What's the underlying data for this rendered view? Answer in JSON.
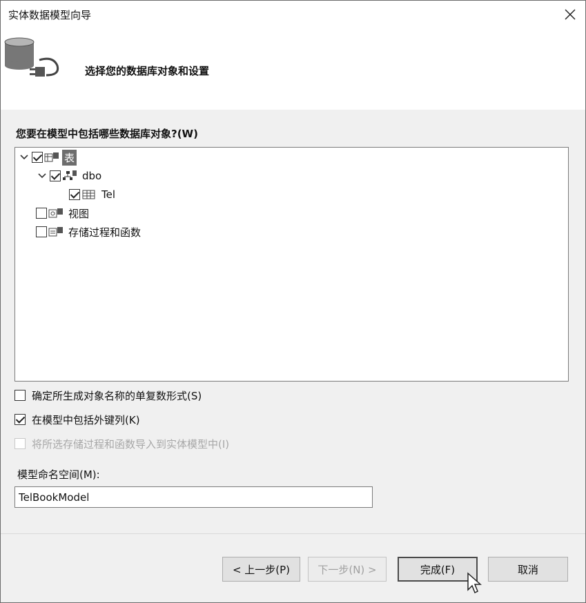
{
  "window": {
    "title": "实体数据模型向导"
  },
  "header": {
    "title": "选择您的数据库对象和设置",
    "icon": "database-connection-icon"
  },
  "objects": {
    "label": "您要在模型中包括哪些数据库对象?(W)",
    "tree": [
      {
        "label": "表",
        "checked": true,
        "expanded": true,
        "selected": true,
        "icon": "tables-icon"
      },
      {
        "label": "dbo",
        "checked": true,
        "expanded": true,
        "selected": false,
        "icon": "schema-icon"
      },
      {
        "label": "Tel",
        "checked": true,
        "selected": false,
        "icon": "table-icon"
      },
      {
        "label": "视图",
        "checked": false,
        "selected": false,
        "icon": "views-icon"
      },
      {
        "label": "存储过程和函数",
        "checked": false,
        "selected": false,
        "icon": "procedures-icon"
      }
    ]
  },
  "options": [
    {
      "label": "确定所生成对象名称的单复数形式(S)",
      "checked": false,
      "enabled": true
    },
    {
      "label": "在模型中包括外键列(K)",
      "checked": true,
      "enabled": true
    },
    {
      "label": "将所选存储过程和函数导入到实体模型中(I)",
      "checked": false,
      "enabled": false
    }
  ],
  "namespace": {
    "label": "模型命名空间(M):",
    "value": "TelBookModel"
  },
  "buttons": {
    "previous": "< 上一步(P)",
    "next": "下一步(N) >",
    "finish": "完成(F)",
    "cancel": "取消"
  },
  "colors": {
    "selection": "#6d6d6d",
    "panel_background": "#f0f0f0"
  }
}
